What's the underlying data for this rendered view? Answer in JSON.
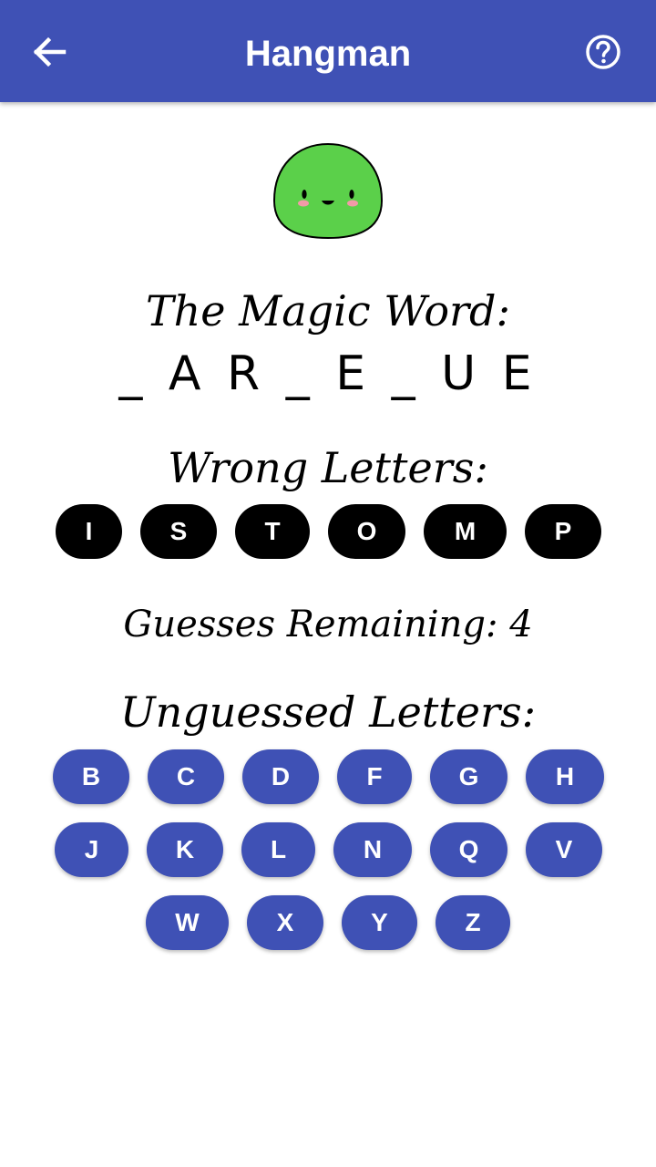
{
  "app_bar": {
    "title": "Hangman",
    "back_icon": "arrow-back-icon",
    "help_icon": "help-circle-icon",
    "color": "#3f51b5"
  },
  "mascot": {
    "icon": "green-blob-mascot",
    "color": "#5bd04a"
  },
  "game": {
    "magic_word_label": "The Magic Word:",
    "magic_word": "_ A R _ E _ U E",
    "wrong_label": "Wrong Letters:",
    "wrong_letters": [
      "I",
      "S",
      "T",
      "O",
      "M",
      "P"
    ],
    "guesses_text": "Guesses Remaining: 4",
    "unguessed_label": "Unguessed Letters:",
    "unguessed_letters": [
      "B",
      "C",
      "D",
      "F",
      "G",
      "H",
      "J",
      "K",
      "L",
      "N",
      "Q",
      "V",
      "W",
      "X",
      "Y",
      "Z"
    ]
  }
}
